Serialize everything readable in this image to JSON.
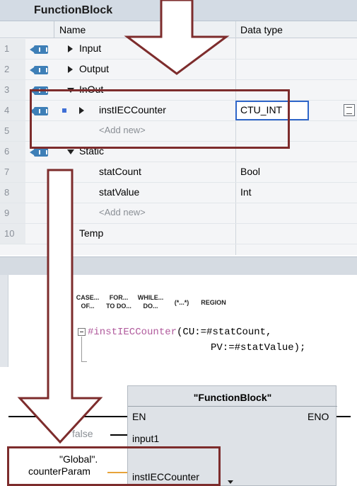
{
  "title": "FunctionBlock",
  "columns": {
    "name": "Name",
    "data_type": "Data type"
  },
  "rows": [
    {
      "num": "1",
      "name": "Input",
      "type": ""
    },
    {
      "num": "2",
      "name": "Output",
      "type": ""
    },
    {
      "num": "3",
      "name": "InOut",
      "type": ""
    },
    {
      "num": "4",
      "name": "instIECCounter",
      "type": "CTU_INT"
    },
    {
      "num": "5",
      "name": "<Add new>",
      "type": ""
    },
    {
      "num": "6",
      "name": "Static",
      "type": ""
    },
    {
      "num": "7",
      "name": "statCount",
      "type": "Bool"
    },
    {
      "num": "8",
      "name": "statValue",
      "type": "Int"
    },
    {
      "num": "9",
      "name": "<Add new>",
      "type": ""
    },
    {
      "num": "10",
      "name": "Temp",
      "type": ""
    }
  ],
  "toolbar": {
    "case_l1": "CASE...",
    "case_l2": "OF...",
    "for_l1": "FOR...",
    "for_l2": "TO DO...",
    "while_l1": "WHILE...",
    "while_l2": "DO...",
    "comment": "(*...*)",
    "region": "REGION"
  },
  "code": {
    "line1_call": "#instIECCounter",
    "line1_args": "(CU:=#statCount,",
    "line2": "PV:=#statValue);"
  },
  "fbd": {
    "block_title": "\"FunctionBlock\"",
    "en": "EN",
    "eno": "ENO",
    "input1": "input1",
    "false_label": "false",
    "inout_pin": "instIECCounter",
    "global_l1": "\"Global\".",
    "global_l2": "counterParam"
  },
  "colors": {
    "highlight": "#7d2c2c",
    "pin": "#3e7fb7",
    "keyword": "#b05a9c",
    "selection": "#2f66c9",
    "wire_orange": "#e8a33a"
  }
}
